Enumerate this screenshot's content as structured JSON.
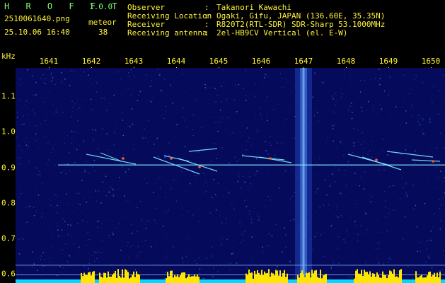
{
  "app": {
    "logo": "H R O F F T",
    "version": "1.0.0"
  },
  "capture": {
    "filename": "2510061640.png",
    "datetime": "25.10.06 16:40",
    "meteor_label": "meteor",
    "meteor_count": "38"
  },
  "info": [
    {
      "label": "Observer",
      "sep": ":",
      "value": "Takanori Kawachi"
    },
    {
      "label": "Receiving Location",
      "sep": ":",
      "value": "Ogaki, Gifu, JAPAN (136.60E, 35.35N)"
    },
    {
      "label": "Receiver",
      "sep": ":",
      "value": "R820T2(RTL-SDR) SDR-Sharp 53.1000MHz"
    },
    {
      "label": "Receiving antenna",
      "sep": ":",
      "value": "2el-HB9CV Vertical (el. E-W)"
    }
  ],
  "spectrogram": {
    "unit_label": "kHz",
    "time_labels": [
      "1641",
      "1642",
      "1643",
      "1644",
      "1645",
      "1646",
      "1647",
      "1648",
      "1649",
      "1650"
    ],
    "freq_labels": [
      "1.1",
      "1.0",
      "0.9",
      "0.8",
      "0.7",
      "0.6"
    ],
    "freq_values": [
      1.1,
      1.0,
      0.9,
      0.8,
      0.7,
      0.6
    ],
    "freq_range_khz": [
      0.575,
      1.18
    ],
    "colors": {
      "background": "#050a5a",
      "labels": "#FFF33A",
      "title": "#7CFF6B",
      "signal": "#7fe9ff",
      "hot": "#ff5a2a",
      "bars": "#FFE600",
      "noise_floor": "#00D8FF"
    }
  }
}
